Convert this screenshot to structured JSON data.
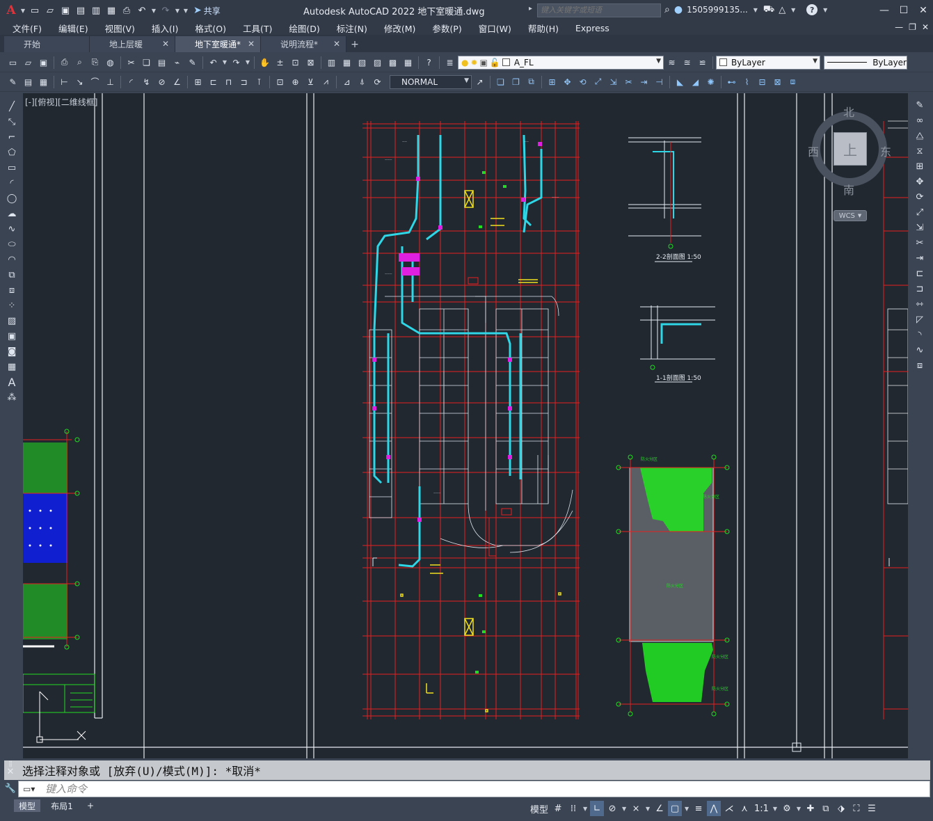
{
  "app": {
    "title": "Autodesk AutoCAD 2022    地下室暖通.dwg",
    "share_label": "共享",
    "search_placeholder": "键入关键字或短语",
    "user_label": "1505999135...",
    "logo": "A"
  },
  "menu": [
    "文件(F)",
    "编辑(E)",
    "视图(V)",
    "插入(I)",
    "格式(O)",
    "工具(T)",
    "绘图(D)",
    "标注(N)",
    "修改(M)",
    "参数(P)",
    "窗口(W)",
    "帮助(H)",
    "Express"
  ],
  "tabs": [
    {
      "label": "开始",
      "closable": false,
      "active": false
    },
    {
      "label": "地上层暖",
      "closable": true,
      "active": false
    },
    {
      "label": "地下室暖通*",
      "closable": true,
      "active": true
    },
    {
      "label": "说明流程*",
      "closable": true,
      "active": false
    }
  ],
  "toolbar": {
    "layer_name": "A_FL",
    "color_value": "ByLayer",
    "linetype_value": "ByLayer",
    "textstyle_value": "NORMAL"
  },
  "viewport": {
    "label": "[-][俯视][二维线框]"
  },
  "viewcube": {
    "north": "北",
    "south": "南",
    "east": "东",
    "west": "西",
    "top": "上",
    "wcs": "WCS"
  },
  "drawing": {
    "section_2": "2-2剖面图 1:50",
    "section_1": "1-1剖面图 1:50",
    "zone_labels": [
      "防火分区",
      "防火分区",
      "防火分区",
      "防火分区",
      "防火分区"
    ]
  },
  "command": {
    "history": "选择注释对象或 [放弃(U)/模式(M)]: *取消*",
    "placeholder": "键入命令"
  },
  "layout_tabs": [
    "模型",
    "布局1"
  ],
  "status": {
    "model_label": "模型",
    "scale": "1:1"
  },
  "colors": {
    "canvas": "#212830",
    "red_line": "#e62020",
    "cyan_duct": "#2fd6e6",
    "magenta": "#e020e0",
    "green_hatch": "#22dd22",
    "blue_fill": "#1020d0"
  }
}
